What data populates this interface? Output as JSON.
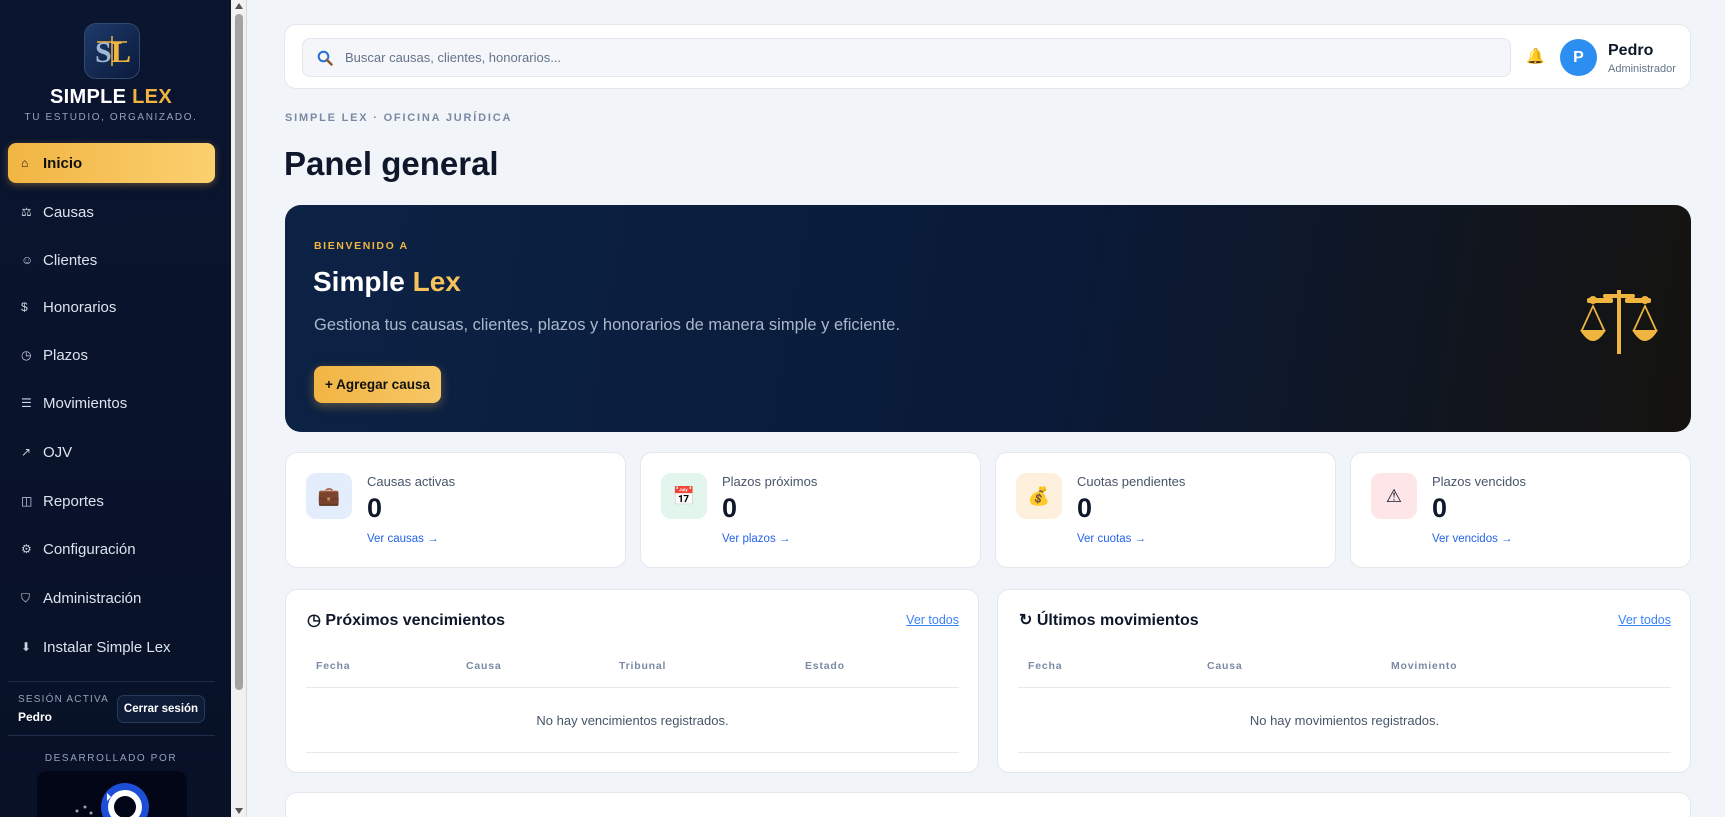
{
  "sidebar": {
    "brand_main": "SIMPLE",
    "brand_accent": "LEX",
    "tagline": "TU ESTUDIO, ORGANIZADO.",
    "items": [
      {
        "label": "Inicio",
        "icon": "home-icon",
        "glyph": "⌂",
        "active": true
      },
      {
        "label": "Causas",
        "icon": "briefcase-icon",
        "glyph": "⚖"
      },
      {
        "label": "Clientes",
        "icon": "user-icon",
        "glyph": "☺"
      },
      {
        "label": "Honorarios",
        "icon": "dollar-icon",
        "glyph": "$"
      },
      {
        "label": "Plazos",
        "icon": "clock-icon",
        "glyph": "◷"
      },
      {
        "label": "Movimientos",
        "icon": "list-icon",
        "glyph": "☰"
      },
      {
        "label": "OJV",
        "icon": "external-link-icon",
        "glyph": "↗"
      },
      {
        "label": "Reportes",
        "icon": "report-icon",
        "glyph": "◫"
      },
      {
        "label": "Configuración",
        "icon": "gear-icon",
        "glyph": "⚙"
      },
      {
        "label": "Administración",
        "icon": "shield-icon",
        "glyph": "⛉"
      },
      {
        "label": "Instalar Simple Lex",
        "icon": "download-icon",
        "glyph": "⬇"
      }
    ],
    "session_label": "SESIÓN ACTIVA",
    "session_user": "Pedro",
    "logout_label": "Cerrar sesión",
    "developed_by": "DESARROLLADO POR"
  },
  "topbar": {
    "search_placeholder": "Buscar causas, clientes, honorarios...",
    "avatar_initial": "P",
    "user_name": "Pedro",
    "user_role": "Administrador"
  },
  "breadcrumb": "SIMPLE LEX · OFICINA JURÍDICA",
  "page_title": "Panel general",
  "hero": {
    "kicker": "BIENVENIDO A",
    "title_main": "Simple",
    "title_accent": "Lex",
    "description": "Gestiona tus causas, clientes, plazos y honorarios de manera simple y eficiente.",
    "cta_label": "+ Agregar causa"
  },
  "stats": [
    {
      "label": "Causas activas",
      "value": "0",
      "link": "Ver causas →",
      "icon": "briefcase-icon",
      "glyph": "💼",
      "bg": "#e3edfb"
    },
    {
      "label": "Plazos próximos",
      "value": "0",
      "link": "Ver plazos →",
      "icon": "calendar-icon",
      "glyph": "📅",
      "bg": "#e2f6ee"
    },
    {
      "label": "Cuotas pendientes",
      "value": "0",
      "link": "Ver cuotas →",
      "icon": "money-bag-icon",
      "glyph": "💰",
      "bg": "#fdf1de"
    },
    {
      "label": "Plazos vencidos",
      "value": "0",
      "link": "Ver vencidos →",
      "icon": "warning-icon",
      "glyph": "⚠",
      "bg": "#fde5e8"
    }
  ],
  "panels": {
    "upcoming": {
      "icon": "clock-icon",
      "glyph": "◷",
      "title": "Próximos vencimientos",
      "link": "Ver todos",
      "columns": [
        "Fecha",
        "Causa",
        "Tribunal",
        "Estado"
      ],
      "empty": "No hay vencimientos registrados."
    },
    "movements": {
      "icon": "refresh-icon",
      "glyph": "↻",
      "title": "Últimos movimientos",
      "link": "Ver todos",
      "columns": [
        "Fecha",
        "Causa",
        "Movimiento"
      ],
      "empty": "No hay movimientos registrados."
    }
  },
  "colors": {
    "accent": "#f0b541",
    "sidebar_bg": "#0a1530",
    "link": "#2563eb"
  }
}
